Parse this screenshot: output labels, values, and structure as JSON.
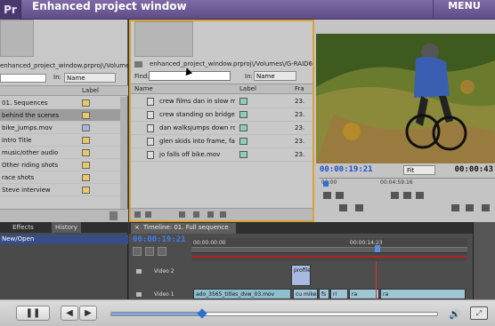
{
  "header": {
    "logo": "Pr",
    "title": "Enhanced project window",
    "menu_label": "MENU"
  },
  "left_panel": {
    "path": "enhanced_project_window.prproj\\/Volumes\\/",
    "in_label": "In:",
    "in_value": "Name",
    "label_header": "Label",
    "items": [
      {
        "name": "01. Sequences",
        "label_color": "#e9c86a",
        "selected": false
      },
      {
        "name": "behind the scenes",
        "label_color": "#e9c86a",
        "selected": true
      },
      {
        "name": "bike_jumps.mov",
        "label_color": "#a9b6d9",
        "selected": false
      },
      {
        "name": "Intro Title",
        "label_color": "#e9c86a",
        "selected": false
      },
      {
        "name": "music/other audio",
        "label_color": "#e9c86a",
        "selected": false
      },
      {
        "name": "Other riding shots",
        "label_color": "#e9c86a",
        "selected": false
      },
      {
        "name": "race shots",
        "label_color": "#e9c86a",
        "selected": false
      },
      {
        "name": "Steve interview",
        "label_color": "#e9c86a",
        "selected": false
      }
    ]
  },
  "center_panel": {
    "path": "enhanced_project_window.prproj\\/Volumes\\/G-RAID",
    "path_tail": "6",
    "find_label": "Find:",
    "in_label": "In:",
    "in_value": "Name",
    "col_name": "Name",
    "col_label": "Label",
    "col_frame": "Fra",
    "items": [
      {
        "name": "crew films dan in slow m",
        "fr": "23."
      },
      {
        "name": "crew standing on bridge1",
        "fr": "23."
      },
      {
        "name": "dan walksjumps down ro",
        "fr": "23."
      },
      {
        "name": "glen skids into frame, fall",
        "fr": "23."
      },
      {
        "name": "jo falls off bike.mov",
        "fr": "23."
      }
    ]
  },
  "monitor": {
    "timecode_left": "00:00:19:21",
    "fit_label": "Fit",
    "timecode_right": "00:00:43",
    "ruler_start": "00:00",
    "ruler_mid": "00:04:59:16"
  },
  "history_panel": {
    "tab_effects": "Effects",
    "tab_history": "History",
    "item": "New/Open"
  },
  "timeline": {
    "tab_label": "Timeline: 01. Full sequence",
    "timecode": "00:00:19:21",
    "ruler_start": "00:00:00:00",
    "ruler_mid": "00:00:14:23",
    "tracks": [
      {
        "name": "Video 2"
      },
      {
        "name": "Video 1"
      }
    ],
    "clips": {
      "v2_clip": "profile",
      "v1_clip_a": "ado_3565_titles_dvw_03.mov",
      "v1_clip_b": "cu mike",
      "v1_clip_c": "fs",
      "v1_clip_d": "ri",
      "v1_clip_e": "ra",
      "v1_clip_f": "ra"
    }
  },
  "player": {
    "progress": 0.28
  }
}
